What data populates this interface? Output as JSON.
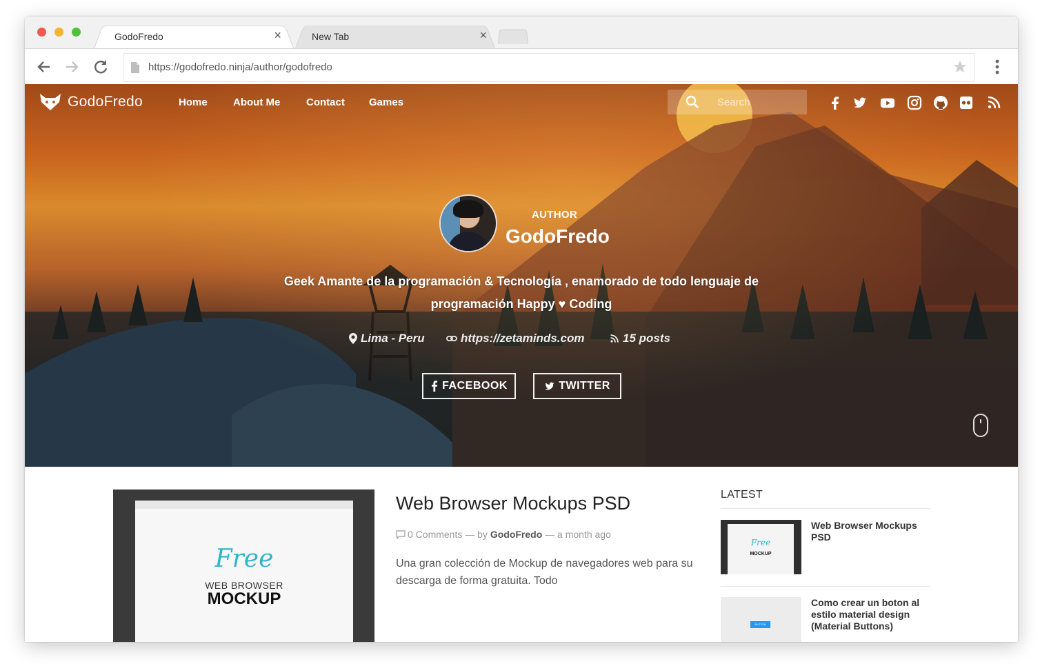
{
  "browser": {
    "tabs": [
      {
        "title": "GodoFredo",
        "active": true
      },
      {
        "title": "New Tab",
        "active": false
      }
    ],
    "close_glyph": "×",
    "url": "https://godofredo.ninja/author/godofredo",
    "colors": {
      "chrome_bg": "#f1f1f1",
      "close_red": "#ee5a52",
      "minimize_yellow": "#f3b52d",
      "zoom_green": "#4fc23a"
    }
  },
  "site": {
    "logo_text": "GodoFredo",
    "nav": [
      "Home",
      "About Me",
      "Contact",
      "Games"
    ],
    "search_placeholder": "Search",
    "social_icons": [
      "facebook-icon",
      "twitter-icon",
      "youtube-icon",
      "instagram-icon",
      "github-icon",
      "flickr-icon",
      "rss-icon"
    ]
  },
  "author": {
    "label": "AUTHOR",
    "name": "GodoFredo",
    "bio_line1": "Geek Amante de la programación & Tecnología , enamorado de todo lenguaje de",
    "bio_line2": "programación Happy ♥ Coding",
    "location": "Lima - Peru",
    "website": "https://zetaminds.com",
    "posts": "15 posts",
    "buttons": {
      "facebook": "FACEBOOK",
      "twitter": "TWITTER"
    }
  },
  "post": {
    "title": "Web Browser Mockups PSD",
    "comments": "0 Comments",
    "by": "— by",
    "author": "GodoFredo",
    "time": "— a month ago",
    "excerpt": "Una gran colección de Mockup de navegadores web para su descarga de forma gratuita. Todo",
    "thumb": {
      "free": "Free",
      "web_browser": "WEB BROWSER",
      "mockup": "MOCKUP"
    }
  },
  "sidebar": {
    "title": "LATEST",
    "items": [
      {
        "title": "Web Browser Mockups PSD",
        "thumb_free": "Free",
        "thumb_mockup": "MOCKUP"
      },
      {
        "title": "Como crear un boton al estilo material design (Material Buttons)",
        "thumb_button": "BUTTON"
      }
    ]
  }
}
